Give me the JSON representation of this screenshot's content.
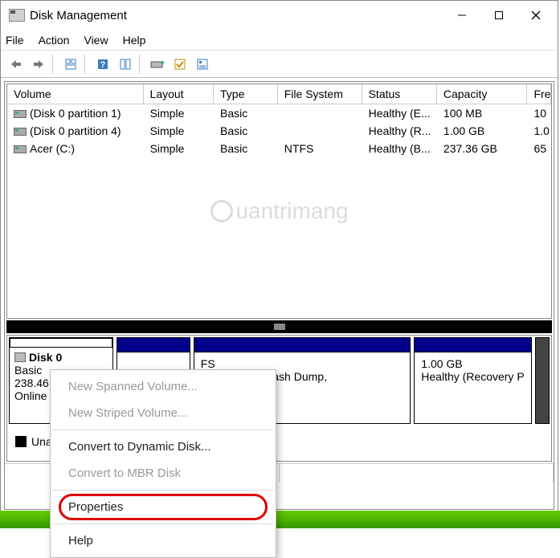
{
  "window": {
    "title": "Disk Management"
  },
  "menubar": {
    "items": [
      "File",
      "Action",
      "View",
      "Help"
    ]
  },
  "columns": {
    "volume": "Volume",
    "layout": "Layout",
    "type": "Type",
    "filesystem": "File System",
    "status": "Status",
    "capacity": "Capacity",
    "free": "Fre"
  },
  "volumes": [
    {
      "name": "(Disk 0 partition 1)",
      "layout": "Simple",
      "type": "Basic",
      "fs": "",
      "status": "Healthy (E...",
      "capacity": "100 MB",
      "free": "10"
    },
    {
      "name": "(Disk 0 partition 4)",
      "layout": "Simple",
      "type": "Basic",
      "fs": "",
      "status": "Healthy (R...",
      "capacity": "1.00 GB",
      "free": "1.0"
    },
    {
      "name": "Acer (C:)",
      "layout": "Simple",
      "type": "Basic",
      "fs": "NTFS",
      "status": "Healthy (B...",
      "capacity": "237.36 GB",
      "free": "65"
    }
  ],
  "watermark": "uantrimang",
  "disk": {
    "label": "Disk 0",
    "type": "Basic",
    "size": "238.46",
    "state": "Online",
    "partitions": {
      "p2": {
        "fs": "FS",
        "detail": ", Page File, Crash Dump,"
      },
      "p3": {
        "size": "1.00 GB",
        "status": "Healthy (Recovery P"
      }
    }
  },
  "legend": {
    "unallocated": "Una"
  },
  "context_menu": {
    "new_spanned": "New Spanned Volume...",
    "new_striped": "New Striped Volume...",
    "convert_dynamic": "Convert to Dynamic Disk...",
    "convert_mbr": "Convert to MBR Disk",
    "properties": "Properties",
    "help": "Help"
  }
}
